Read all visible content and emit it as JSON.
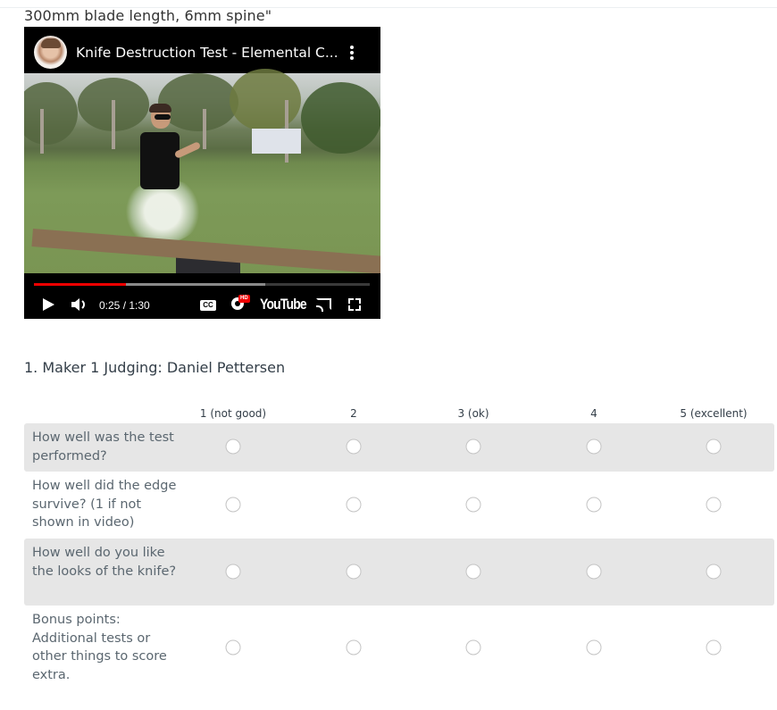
{
  "intro_text": "300mm blade length, 6mm spine\"",
  "video": {
    "title": "Knife Destruction Test - Elemental C...",
    "current_time": "0:25",
    "duration": "1:30",
    "time_display": "0:25 / 1:30",
    "played_fraction": 0.275,
    "buffered_fraction": 0.69,
    "cc_label": "CC",
    "hd_badge": "HD",
    "logo_text": "YouTube",
    "icons": [
      "avatar",
      "more-options-icon",
      "play-icon",
      "volume-icon",
      "captions-icon",
      "settings-icon",
      "youtube-logo",
      "cast-icon",
      "fullscreen-icon"
    ],
    "colors": {
      "progress_played": "#ee0000",
      "background": "#000000"
    }
  },
  "question": {
    "number": "1.",
    "title": "1. Maker 1 Judging: Daniel Pettersen",
    "columns": [
      "1 (not good)",
      "2",
      "3 (ok)",
      "4",
      "5 (excellent)"
    ],
    "rows": [
      {
        "label": "How well was the test performed?",
        "selected": null
      },
      {
        "label": "How well did the edge survive? (1 if not shown in video)",
        "selected": null
      },
      {
        "label": "How well do you like the looks of the knife?",
        "selected": null
      },
      {
        "label": "Bonus points: Additional tests or other things to score extra.",
        "selected": null
      }
    ]
  }
}
